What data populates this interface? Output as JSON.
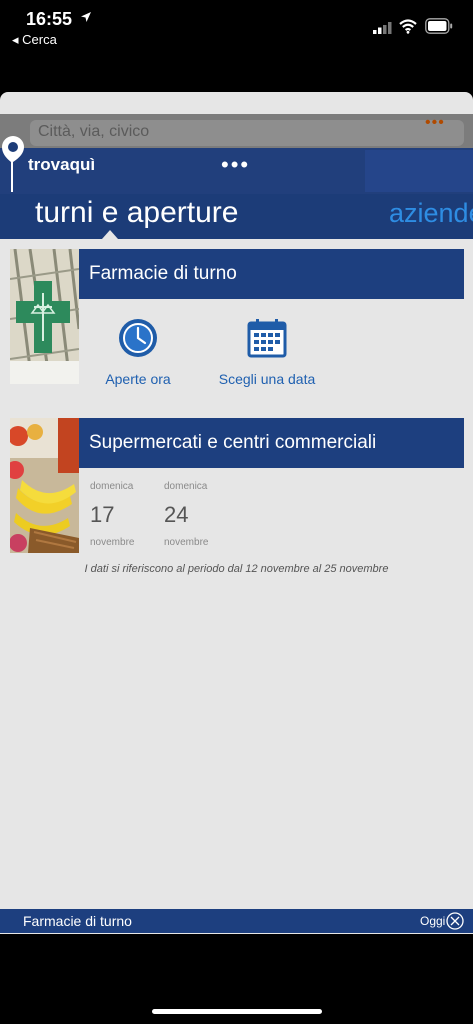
{
  "status": {
    "time": "16:55",
    "back_label": "◂ Cerca"
  },
  "search": {
    "placeholder": "Città, via, civico",
    "menu_dots": "•••"
  },
  "header": {
    "logo": "trovaquì",
    "menu_dots": "•••",
    "active_tab": "turni e aperture",
    "next_tab": "aziende"
  },
  "pharmacy": {
    "title": "Farmacie di turno",
    "actions": [
      {
        "label": "Aperte ora",
        "icon": "clock-icon"
      },
      {
        "label": "Scegli una data",
        "icon": "calendar-icon"
      }
    ]
  },
  "supermarkets": {
    "title": "Supermercati e centri commerciali",
    "dates": [
      {
        "weekday": "domenica",
        "day": "17",
        "month": "novembre"
      },
      {
        "weekday": "domenica",
        "day": "24",
        "month": "novembre"
      }
    ],
    "note": "I dati si riferiscono al periodo dal 12 novembre al 25 novembre"
  },
  "bottom_bar": {
    "label": "Farmacie di turno",
    "today": "Oggi"
  },
  "colors": {
    "navy": "#1d3f7f",
    "accent_blue": "#2e8de3",
    "background": "#e6e6e6"
  }
}
